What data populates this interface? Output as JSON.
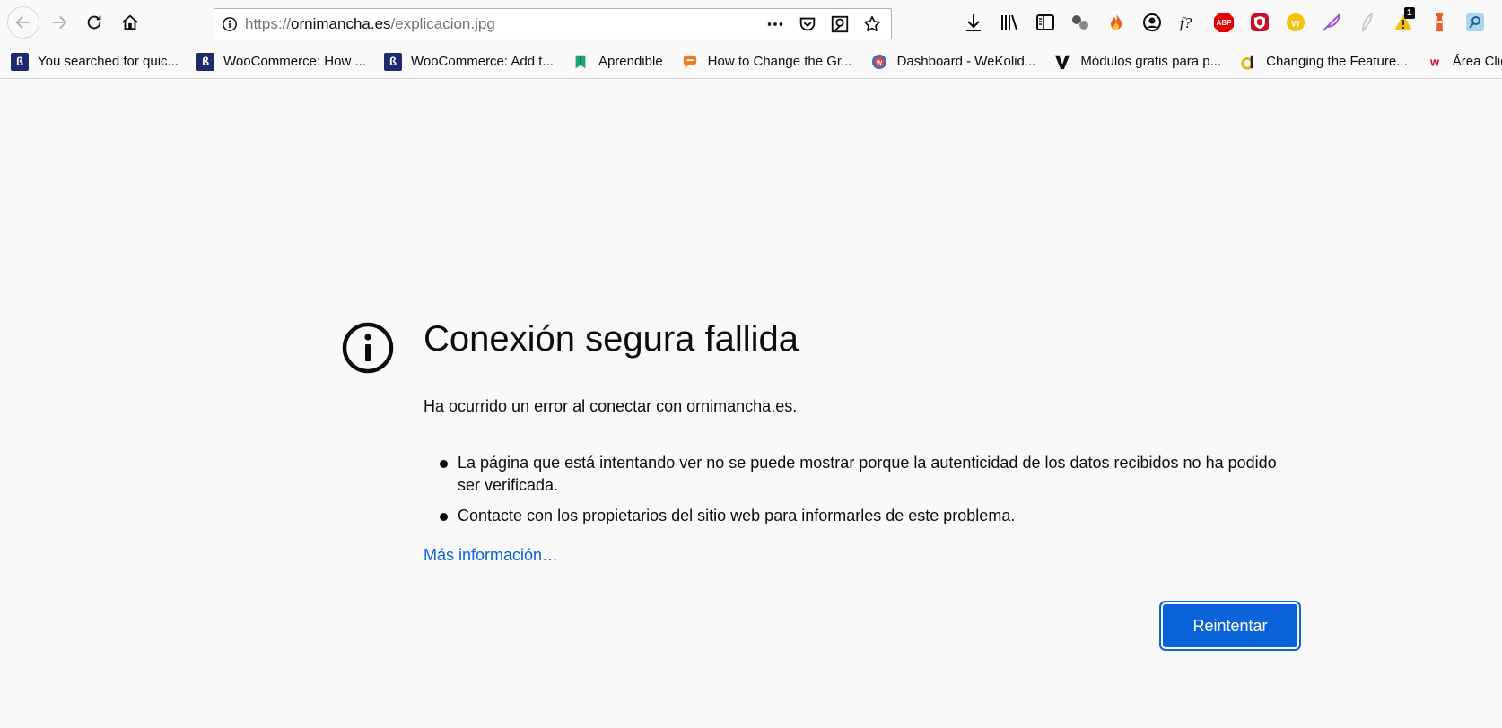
{
  "browser": {
    "url": {
      "scheme": "https://",
      "host": "ornimancha.es",
      "path": "/explicacion.jpg"
    },
    "bookmarks": [
      {
        "label": "You searched for quic...",
        "icon": "b-logo-icon",
        "color": "#1d2a6b"
      },
      {
        "label": "WooCommerce: How ...",
        "icon": "b-logo-icon",
        "color": "#1d2a6b"
      },
      {
        "label": "WooCommerce: Add t...",
        "icon": "b-logo-icon",
        "color": "#1d2a6b"
      },
      {
        "label": "Aprendible",
        "icon": "bookmark-flag-icon",
        "color": "#1aa37a"
      },
      {
        "label": "How to Change the Gr...",
        "icon": "chat-bubble-icon",
        "color": "#f07c1e"
      },
      {
        "label": "Dashboard - WeKolid...",
        "icon": "w-circle-icon",
        "color": "#3b6fc4"
      },
      {
        "label": "Módulos gratis para p...",
        "icon": "v-logo-icon",
        "color": "#111111"
      },
      {
        "label": "Changing the Feature...",
        "icon": "d-logo-icon",
        "color": "#e8b300"
      },
      {
        "label": "Área Cliente - web...",
        "icon": "w-red-icon",
        "color": "#d0021b"
      }
    ],
    "notification_count": "1"
  },
  "error": {
    "title": "Conexión segura fallida",
    "intro": "Ha ocurrido un error al conectar con ornimancha.es.",
    "bullets": [
      "La página que está intentando ver no se puede mostrar porque la autenticidad de los datos recibidos no ha podido ser verificada.",
      "Contacte con los propietarios del sitio web para informarles de este problema."
    ],
    "learn_more": "Más información…",
    "retry_label": "Reintentar"
  },
  "colors": {
    "accent": "#0a63d8",
    "page_bg": "#f9f9fa"
  }
}
